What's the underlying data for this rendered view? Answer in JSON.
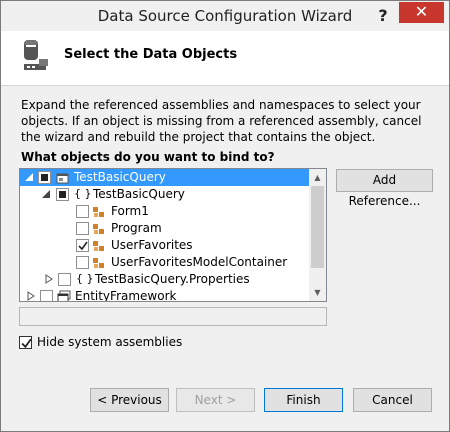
{
  "window": {
    "title": "Data Source Configuration Wizard",
    "help_label": "?",
    "close_label": "✕"
  },
  "header": {
    "title": "Select the Data Objects"
  },
  "description": "Expand the referenced assemblies and namespaces to select your objects. If an object is missing from a referenced assembly, cancel the wizard and rebuild the project that contains the object.",
  "question": "What objects do you want to bind to?",
  "tree": {
    "items": [
      {
        "label": "TestBasicQuery",
        "check": "partial",
        "expanded": true,
        "selected": true,
        "icon": "assembly-icon"
      },
      {
        "label": "TestBasicQuery",
        "check": "partial",
        "expanded": true,
        "icon": "namespace-icon"
      },
      {
        "label": "Form1",
        "check": "unchecked",
        "icon": "class-icon"
      },
      {
        "label": "Program",
        "check": "unchecked",
        "icon": "class-icon"
      },
      {
        "label": "UserFavorites",
        "check": "checked",
        "icon": "class-icon"
      },
      {
        "label": "UserFavoritesModelContainer",
        "check": "unchecked",
        "icon": "class-icon"
      },
      {
        "label": "TestBasicQuery.Properties",
        "check": "unchecked",
        "expanded": false,
        "icon": "namespace-icon"
      },
      {
        "label": "EntityFramework",
        "check": "unchecked",
        "expanded": false,
        "icon": "reference-icon"
      }
    ]
  },
  "buttons": {
    "add_reference": "Add Reference...",
    "hide_system_assemblies": "Hide system assemblies",
    "hide_system_assemblies_checked": true,
    "previous": "< Previous",
    "next": "Next >",
    "finish": "Finish",
    "cancel": "Cancel"
  },
  "colors": {
    "selection": "#3399ff",
    "close_button": "#c7372e",
    "class_icon": "#d0822a"
  }
}
